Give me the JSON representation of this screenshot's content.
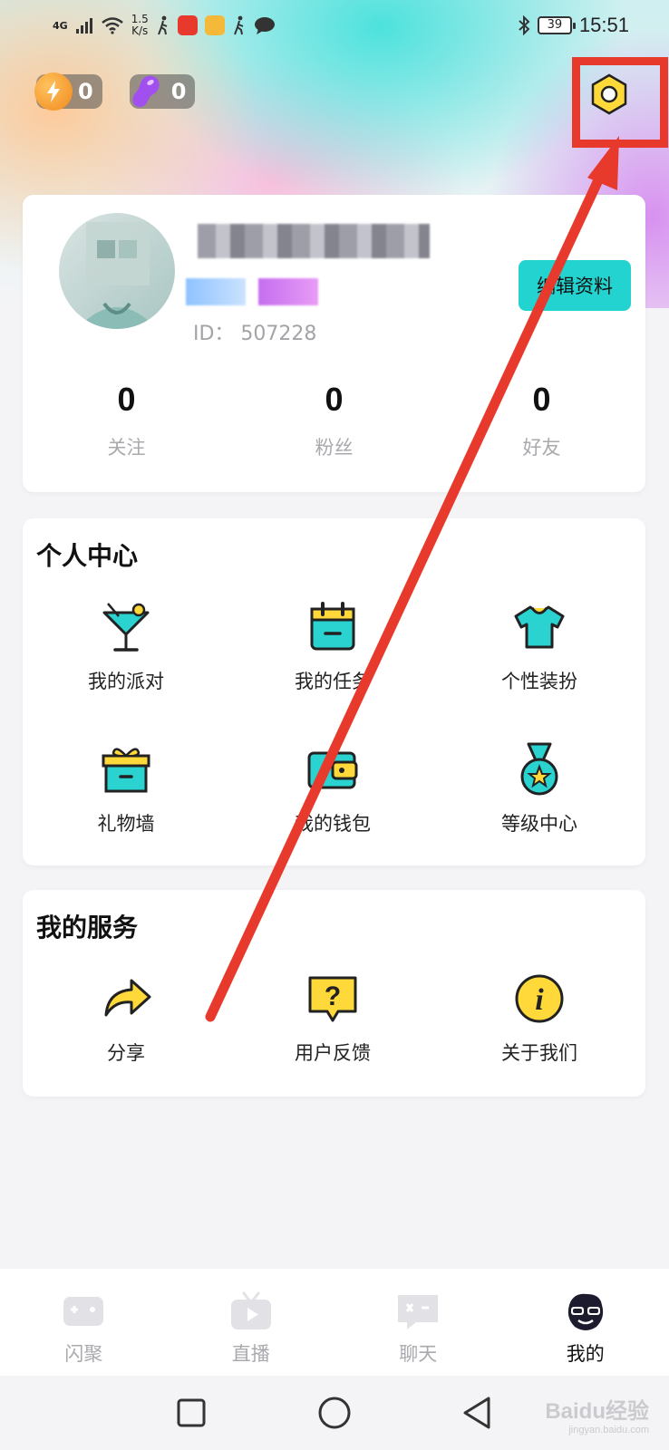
{
  "status_bar": {
    "network": "4G",
    "speed_value": "1.5",
    "speed_unit": "K/s",
    "battery": "39",
    "time": "15:51"
  },
  "currency": {
    "energy": "0",
    "beans": "0"
  },
  "profile": {
    "user_id": "ID： 507228",
    "edit_label": "编辑资料",
    "stats": [
      {
        "value": "0",
        "label": "关注"
      },
      {
        "value": "0",
        "label": "粉丝"
      },
      {
        "value": "0",
        "label": "好友"
      }
    ]
  },
  "personal_center": {
    "title": "个人中心",
    "items": [
      {
        "label": "我的派对",
        "icon": "cocktail-icon"
      },
      {
        "label": "我的任务",
        "icon": "calendar-icon"
      },
      {
        "label": "个性装扮",
        "icon": "tshirt-icon"
      },
      {
        "label": "礼物墙",
        "icon": "gift-icon"
      },
      {
        "label": "我的钱包",
        "icon": "wallet-icon"
      },
      {
        "label": "等级中心",
        "icon": "medal-icon"
      }
    ]
  },
  "services": {
    "title": "我的服务",
    "items": [
      {
        "label": "分享",
        "icon": "share-icon"
      },
      {
        "label": "用户反馈",
        "icon": "feedback-icon"
      },
      {
        "label": "关于我们",
        "icon": "info-icon"
      }
    ]
  },
  "bottom_nav": [
    {
      "label": "闪聚",
      "icon": "gamepad-icon"
    },
    {
      "label": "直播",
      "icon": "tv-icon"
    },
    {
      "label": "聊天",
      "icon": "chat-icon"
    },
    {
      "label": "我的",
      "icon": "profile-face-icon",
      "active": true
    }
  ],
  "watermark": {
    "brand": "Baidu经验",
    "url": "jingyan.baidu.com"
  },
  "colors": {
    "accent": "#22d3cf",
    "icon_teal": "#2bd3d0",
    "icon_yellow": "#ffd93a",
    "annotation_red": "#e8392d"
  }
}
